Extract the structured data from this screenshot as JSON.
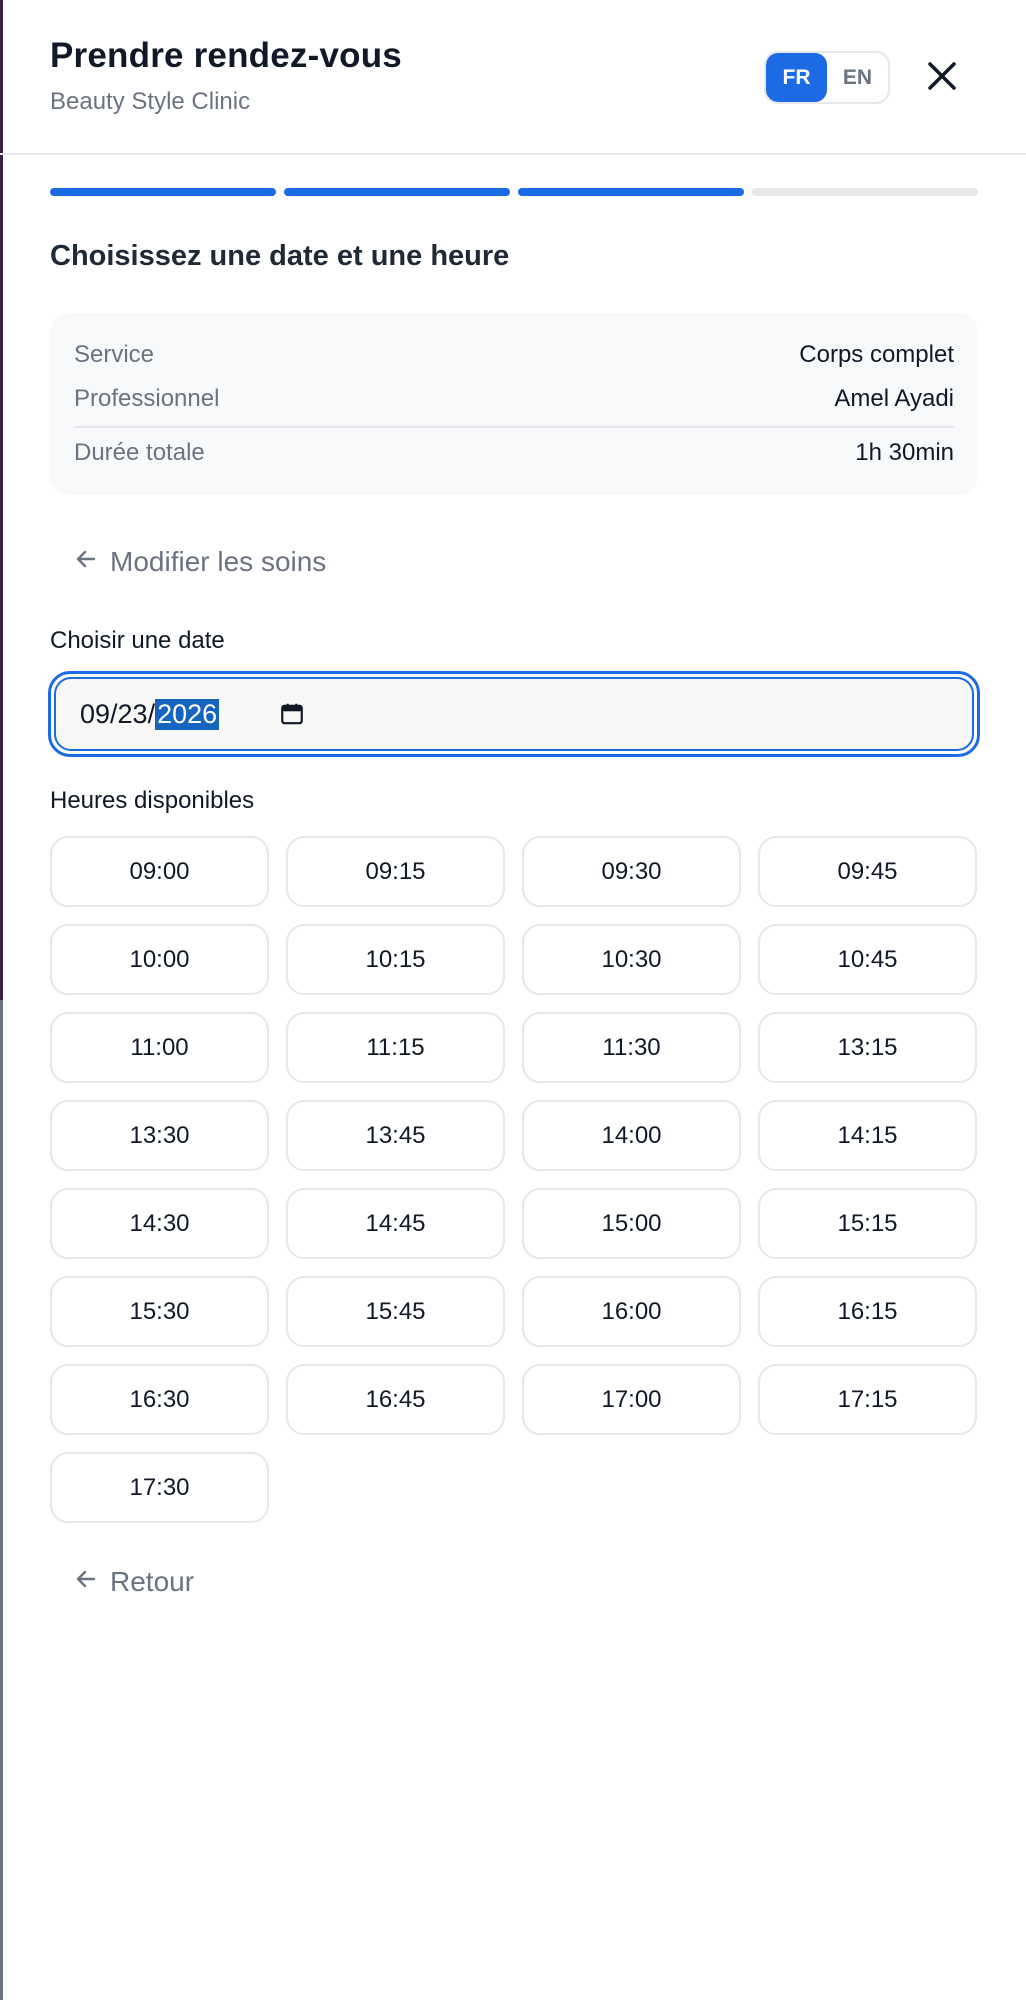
{
  "header": {
    "title": "Prendre rendez-vous",
    "subtitle": "Beauty Style Clinic",
    "languages": [
      {
        "label": "FR",
        "active": true
      },
      {
        "label": "EN",
        "active": false
      }
    ],
    "close_icon": "close-icon"
  },
  "progress": {
    "total_steps": 4,
    "completed_steps": 3,
    "accent_color": "#1d6ae5"
  },
  "step_title": "Choisissez une date et une heure",
  "summary": {
    "service_label": "Service",
    "service_value": "Corps complet",
    "professional_label": "Professionnel",
    "professional_value": "Amel Ayadi",
    "duration_label": "Durée totale",
    "duration_value": "1h 30min"
  },
  "modify_link": "Modifier les soins",
  "date": {
    "label": "Choisir une date",
    "month_day": "09/23/",
    "year": "2026",
    "calendar_icon": "calendar-icon"
  },
  "hours": {
    "label": "Heures disponibles",
    "slots": [
      "09:00",
      "09:15",
      "09:30",
      "09:45",
      "10:00",
      "10:15",
      "10:30",
      "10:45",
      "11:00",
      "11:15",
      "11:30",
      "13:15",
      "13:30",
      "13:45",
      "14:00",
      "14:15",
      "14:30",
      "14:45",
      "15:00",
      "15:15",
      "15:30",
      "15:45",
      "16:00",
      "16:15",
      "16:30",
      "16:45",
      "17:00",
      "17:15",
      "17:30"
    ]
  },
  "back_link": "Retour"
}
